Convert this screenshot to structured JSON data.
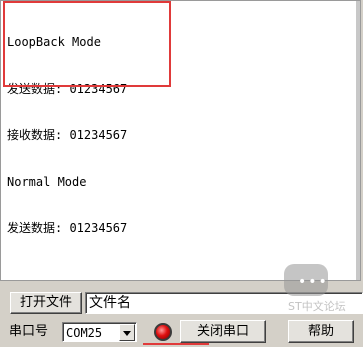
{
  "receive_area": {
    "lines": [
      "LoopBack Mode",
      "发送数据: 01234567",
      "接收数据: 01234567",
      "Normal Mode",
      "发送数据: 01234567"
    ]
  },
  "file_row": {
    "open_file_label": "打开文件",
    "file_name_value": "文件名"
  },
  "port_row": {
    "port_label": "串口号",
    "port_value": "COM25",
    "close_port_label": "关闭串口",
    "help_label": "帮助"
  },
  "watermark": {
    "text": "ST中文论坛"
  },
  "colors": {
    "highlight": "#e03a3a",
    "led": "#e01010"
  }
}
